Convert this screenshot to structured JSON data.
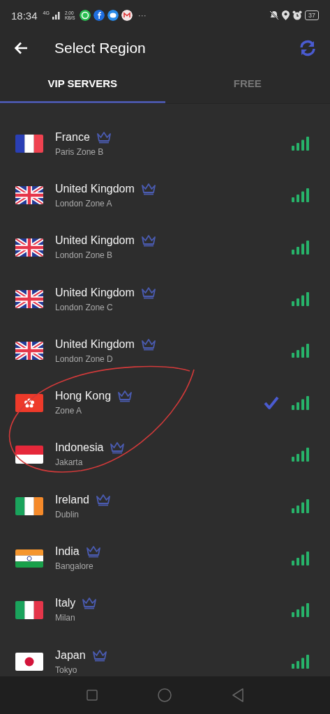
{
  "status_bar": {
    "time": "18:34",
    "network": "4G",
    "speed_value": "2.00",
    "speed_unit": "KB/S",
    "more": "···",
    "battery": "37"
  },
  "header": {
    "title": "Select Region"
  },
  "tabs": [
    {
      "label": "VIP SERVERS",
      "selected": true
    },
    {
      "label": "FREE",
      "selected": false
    }
  ],
  "servers": [
    {
      "country": "France",
      "location": "Paris Zone B",
      "kind": "fr",
      "vip": true,
      "selected": false
    },
    {
      "country": "United Kingdom",
      "location": "London Zone A",
      "kind": "gb",
      "vip": true,
      "selected": false
    },
    {
      "country": "United Kingdom",
      "location": "London Zone B",
      "kind": "gb",
      "vip": true,
      "selected": false
    },
    {
      "country": "United Kingdom",
      "location": "London Zone C",
      "kind": "gb",
      "vip": true,
      "selected": false
    },
    {
      "country": "United Kingdom",
      "location": "London Zone D",
      "kind": "gb",
      "vip": true,
      "selected": false
    },
    {
      "country": "Hong Kong",
      "location": "Zone A",
      "kind": "hk",
      "vip": true,
      "selected": true
    },
    {
      "country": "Indonesia",
      "location": "Jakarta",
      "kind": "id",
      "vip": true,
      "selected": false
    },
    {
      "country": "Ireland",
      "location": "Dublin",
      "kind": "ie",
      "vip": true,
      "selected": false
    },
    {
      "country": "India",
      "location": "Bangalore",
      "kind": "in",
      "vip": true,
      "selected": false
    },
    {
      "country": "Italy",
      "location": "Milan",
      "kind": "it",
      "vip": true,
      "selected": false
    },
    {
      "country": "Japan",
      "location": "Tokyo",
      "kind": "jp",
      "vip": true,
      "selected": false
    }
  ]
}
